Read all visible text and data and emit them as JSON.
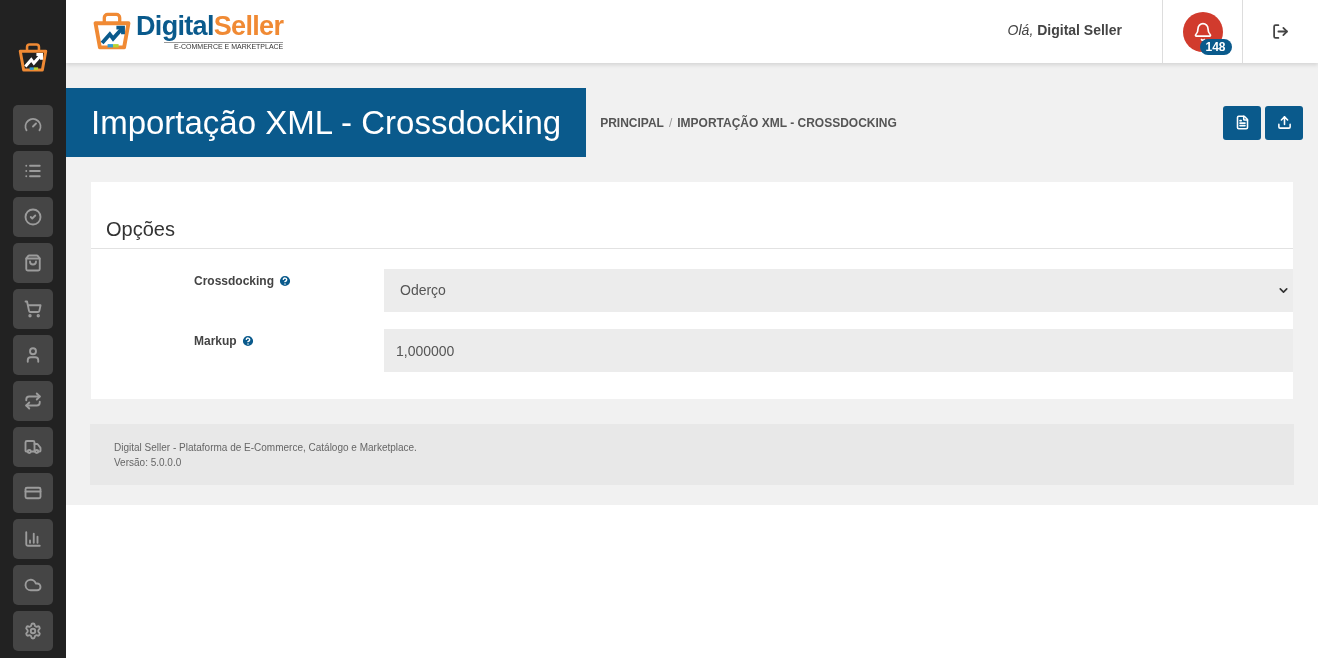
{
  "sidebar": {
    "items": [
      {
        "kind": "dashboard"
      },
      {
        "kind": "list"
      },
      {
        "kind": "check"
      },
      {
        "kind": "bag"
      },
      {
        "kind": "cart"
      },
      {
        "kind": "user"
      },
      {
        "kind": "repeat"
      },
      {
        "kind": "truck"
      },
      {
        "kind": "card"
      },
      {
        "kind": "chart"
      },
      {
        "kind": "cloud"
      },
      {
        "kind": "settings"
      }
    ]
  },
  "header": {
    "logo": {
      "word_1": "Digital",
      "word_2": "Seller",
      "tagline": "E-COMMERCE E MARKETPLACE"
    },
    "greeting": "*Olá,* **Digital Seller**",
    "notifications": {
      "count": "148"
    }
  },
  "page": {
    "title": "Importação XML - Crossdocking",
    "breadcrumb": [
      "PRINCIPAL",
      "/",
      "IMPORTAÇÃO XML - CROSSDOCKING"
    ],
    "actions": [
      {
        "kind": "file"
      },
      {
        "kind": "upload"
      }
    ]
  },
  "section": {
    "title": "Opções",
    "fields": [
      {
        "label": "Crossdocking",
        "kind": "select",
        "value": "Oderço"
      },
      {
        "label": "Markup",
        "kind": "input",
        "value": "1,000000"
      }
    ]
  },
  "footer": {
    "lines": [
      "Digital Seller - Plataforma de E-Commerce, Catálogo e Marketplace.",
      "Versão: 5.0.0.0"
    ]
  }
}
